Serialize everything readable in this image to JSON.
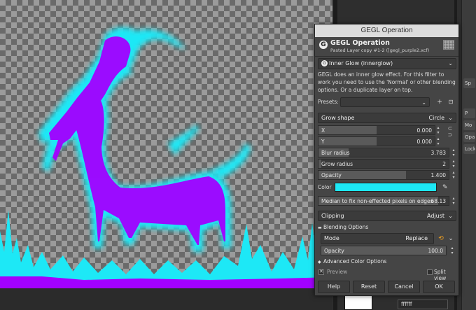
{
  "dialog": {
    "title": "GEGL Operation",
    "header_title": "GEGL Operation",
    "header_subtitle": "Pasted Layer copy #1-2 ([gegl_purple2.xcf)",
    "filter_combo": "Inner Glow (innerglow)",
    "description": "GEGL does an inner glow effect. For this filter to work you need to use the 'Normal' or other blending options. Or a duplicate layer on top.",
    "presets_label": "Presets:",
    "grow_shape": {
      "label": "Grow shape",
      "value": "Circle"
    },
    "x": {
      "label": "X",
      "value": "0.000"
    },
    "y": {
      "label": "Y",
      "value": "0.000"
    },
    "blur_radius": {
      "label": "Blur radius",
      "value": "3.783",
      "fraction": 0.23
    },
    "grow_radius": {
      "label": "Grow radius",
      "value": "2",
      "fraction": 0.02
    },
    "opacity": {
      "label": "Opacity",
      "value": "1.400",
      "fraction": 0.67
    },
    "color": {
      "label": "Color",
      "value": "#1de8f6"
    },
    "median": {
      "label": "Median to fix non-effected pixels on edges",
      "value": "68.13",
      "fraction": 0.92
    },
    "clipping": {
      "label": "Clipping",
      "value": "Adjust"
    },
    "blending_options_label": "Blending Options",
    "mode": {
      "label": "Mode",
      "value": "Replace"
    },
    "blend_opacity": {
      "label": "Opacity",
      "value": "100.0",
      "fraction": 1.0
    },
    "advanced_color_label": "Advanced Color Options",
    "preview_label": "Preview",
    "split_view_label": "Split view",
    "buttons": {
      "help": "Help",
      "reset": "Reset",
      "cancel": "Cancel",
      "ok": "OK"
    }
  },
  "dock": {
    "tabs": [
      "Sp",
      "P",
      "Mo",
      "Opa",
      "Lock"
    ],
    "bottom_field": "ffffff"
  },
  "colors": {
    "glow": "#1de8f6",
    "body": "#a200ff"
  }
}
